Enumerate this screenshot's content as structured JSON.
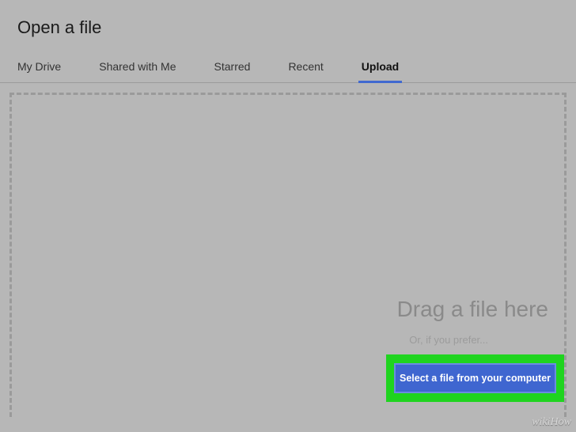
{
  "dialog": {
    "title": "Open a file"
  },
  "tabs": {
    "items": [
      {
        "label": "My Drive"
      },
      {
        "label": "Shared with Me"
      },
      {
        "label": "Starred"
      },
      {
        "label": "Recent"
      },
      {
        "label": "Upload"
      }
    ],
    "active_index": 4
  },
  "dropzone": {
    "drag_text": "Drag a file here",
    "or_text": "Or, if you prefer...",
    "select_button": "Select a file from your computer"
  },
  "watermark": "wikiHow"
}
